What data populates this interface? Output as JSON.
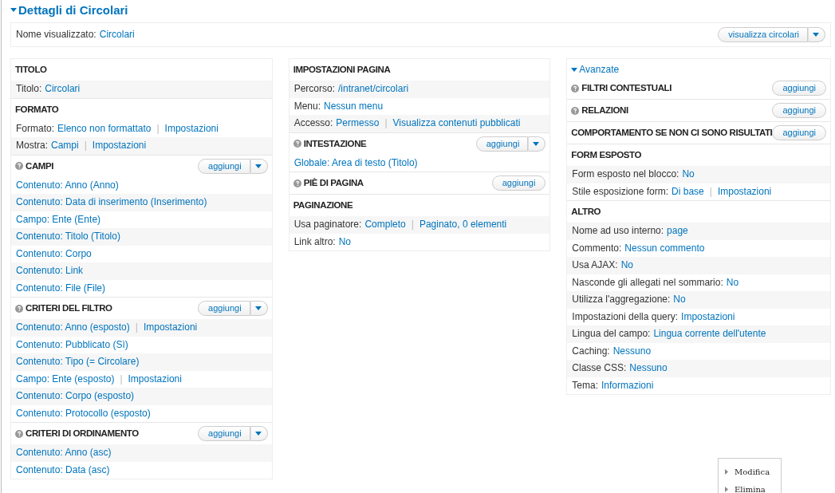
{
  "title": "Dettagli di Circolari",
  "display_name": {
    "label": "Nome visualizzato:",
    "value": "Circolari",
    "button": {
      "label": "visualizza circolari",
      "dropdown": true
    }
  },
  "columns": [
    {
      "sections": [
        {
          "title": "TITOLO",
          "help": false,
          "rows": [
            {
              "label": "Titolo:",
              "links": [
                "Circolari"
              ],
              "shaded": true
            }
          ]
        },
        {
          "title": "FORMATO",
          "help": false,
          "rows": [
            {
              "label": "Formato:",
              "links": [
                "Elenco non formattato",
                "Impostazioni"
              ],
              "separator": "|",
              "shaded": false
            },
            {
              "label": "Mostra:",
              "links": [
                "Campi",
                "Impostazioni"
              ],
              "separator": "|",
              "shaded": true
            }
          ]
        },
        {
          "title": "CAMPI",
          "help": true,
          "add_button": {
            "label": "aggiungi",
            "dropdown": true
          },
          "rows": [
            {
              "links": [
                "Contenuto: Anno (Anno)"
              ],
              "shaded": false
            },
            {
              "links": [
                "Contenuto: Data di inserimento (Inserimento)"
              ],
              "shaded": true
            },
            {
              "links": [
                "Campo: Ente (Ente)"
              ],
              "shaded": false
            },
            {
              "links": [
                "Contenuto: Titolo (Titolo)"
              ],
              "shaded": true
            },
            {
              "links": [
                "Contenuto: Corpo"
              ],
              "shaded": false
            },
            {
              "links": [
                "Contenuto: Link"
              ],
              "shaded": true
            },
            {
              "links": [
                "Contenuto: File (File)"
              ],
              "shaded": false
            }
          ]
        },
        {
          "title": "CRITERI DEL FILTRO",
          "help": true,
          "add_button": {
            "label": "aggiungi",
            "dropdown": true
          },
          "rows": [
            {
              "links": [
                "Contenuto: Anno (esposto)",
                "Impostazioni"
              ],
              "separator": "|",
              "shaded": true
            },
            {
              "links": [
                "Contenuto: Pubblicato (Sì)"
              ],
              "shaded": false
            },
            {
              "links": [
                "Contenuto: Tipo (= Circolare)"
              ],
              "shaded": true
            },
            {
              "links": [
                "Campo: Ente (esposto)",
                "Impostazioni"
              ],
              "separator": "|",
              "shaded": false
            },
            {
              "links": [
                "Contenuto: Corpo (esposto)"
              ],
              "shaded": true
            },
            {
              "links": [
                "Contenuto: Protocollo (esposto)"
              ],
              "shaded": false
            }
          ]
        },
        {
          "title": "CRITERI DI ORDINAMENTO",
          "help": true,
          "add_button": {
            "label": "aggiungi",
            "dropdown": true
          },
          "rows": [
            {
              "links": [
                "Contenuto: Anno (asc)"
              ],
              "shaded": true
            },
            {
              "links": [
                "Contenuto: Data (asc)"
              ],
              "shaded": false
            }
          ]
        }
      ]
    },
    {
      "sections": [
        {
          "title": "IMPOSTAZIONI PAGINA",
          "help": false,
          "rows": [
            {
              "label": "Percorso:",
              "links": [
                "/intranet/circolari"
              ],
              "shaded": true
            },
            {
              "label": "Menu:",
              "links": [
                "Nessun menu"
              ],
              "shaded": false
            },
            {
              "label": "Accesso:",
              "links": [
                "Permesso",
                "Visualizza contenuti pubblicati"
              ],
              "separator": "|",
              "shaded": true
            }
          ]
        },
        {
          "title": "INTESTAZIONE",
          "help": true,
          "add_button": {
            "label": "aggiungi",
            "dropdown": true
          },
          "rows": [
            {
              "links": [
                "Globale: Area di testo (Titolo)"
              ],
              "shaded": false
            }
          ]
        },
        {
          "title": "PIÈ DI PAGINA",
          "help": true,
          "add_button": {
            "label": "aggiungi",
            "dropdown": false
          }
        },
        {
          "title": "PAGINAZIONE",
          "help": false,
          "rows": [
            {
              "label": "Usa paginatore:",
              "links": [
                "Completo",
                "Paginato, 0 elementi"
              ],
              "separator": "|",
              "shaded": true
            },
            {
              "label": "Link altro:",
              "links": [
                "No"
              ],
              "shaded": false
            }
          ]
        }
      ]
    },
    {
      "toggle": "Avanzate",
      "sections": [
        {
          "title": "FILTRI CONTESTUALI",
          "help": true,
          "add_button": {
            "label": "aggiungi",
            "dropdown": false
          }
        },
        {
          "title": "RELAZIONI",
          "help": true,
          "add_button": {
            "label": "aggiungi",
            "dropdown": false
          }
        },
        {
          "title": "COMPORTAMENTO SE NON CI SONO RISULTATI",
          "help": false,
          "add_button": {
            "label": "aggiungi",
            "dropdown": false
          }
        },
        {
          "title": "FORM ESPOSTO",
          "help": false,
          "rows": [
            {
              "label": "Form esposto nel blocco:",
              "links": [
                "No"
              ],
              "shaded": true
            },
            {
              "label": "Stile esposizione form:",
              "links": [
                "Di base",
                "Impostazioni"
              ],
              "separator": "|",
              "shaded": false
            }
          ]
        },
        {
          "title": "ALTRO",
          "help": false,
          "rows": [
            {
              "label": "Nome ad uso interno:",
              "links": [
                "page"
              ],
              "shaded": true
            },
            {
              "label": "Commento:",
              "links": [
                "Nessun commento"
              ],
              "shaded": false
            },
            {
              "label": "Usa AJAX:",
              "links": [
                "No"
              ],
              "shaded": true
            },
            {
              "label": "Nasconde gli allegati nel sommario:",
              "links": [
                "No"
              ],
              "shaded": false
            },
            {
              "label": "Utilizza l'aggregazione:",
              "links": [
                "No"
              ],
              "shaded": true
            },
            {
              "label": "Impostazioni della query:",
              "links": [
                "Impostazioni"
              ],
              "shaded": false
            },
            {
              "label": "Lingua del campo:",
              "links": [
                "Lingua corrente dell'utente"
              ],
              "shaded": true
            },
            {
              "label": "Caching:",
              "links": [
                "Nessuno"
              ],
              "shaded": false
            },
            {
              "label": "Classe CSS:",
              "links": [
                "Nessuno"
              ],
              "shaded": true
            },
            {
              "label": "Tema:",
              "links": [
                "Informazioni"
              ],
              "shaded": false
            }
          ]
        }
      ]
    }
  ],
  "context_menu": [
    "Modifica",
    "Elimina"
  ]
}
